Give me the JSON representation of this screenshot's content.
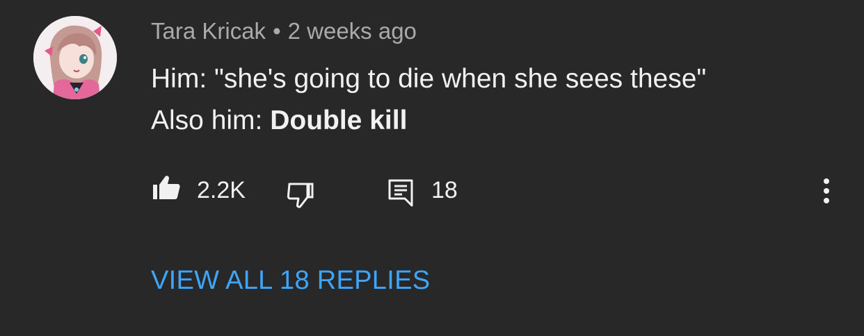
{
  "comment": {
    "author": "Tara Kricak",
    "separator": "•",
    "timestamp": "2 weeks ago",
    "line1": "Him: \"she's going to die when she sees these\"",
    "line2_prefix": "Also him: ",
    "line2_bold": "Double kill"
  },
  "actions": {
    "like_icon": "thumbs-up-filled",
    "like_count": "2.2K",
    "dislike_icon": "thumbs-down-outline",
    "reply_icon": "comment-reply",
    "reply_count": "18",
    "more_icon": "more-vertical"
  },
  "replies": {
    "view_all_label": "VIEW ALL 18 REPLIES"
  },
  "colors": {
    "background": "#282828",
    "primary_text": "#f1f1f1",
    "secondary_text": "#aaaaaa",
    "link": "#3ea6ff"
  }
}
